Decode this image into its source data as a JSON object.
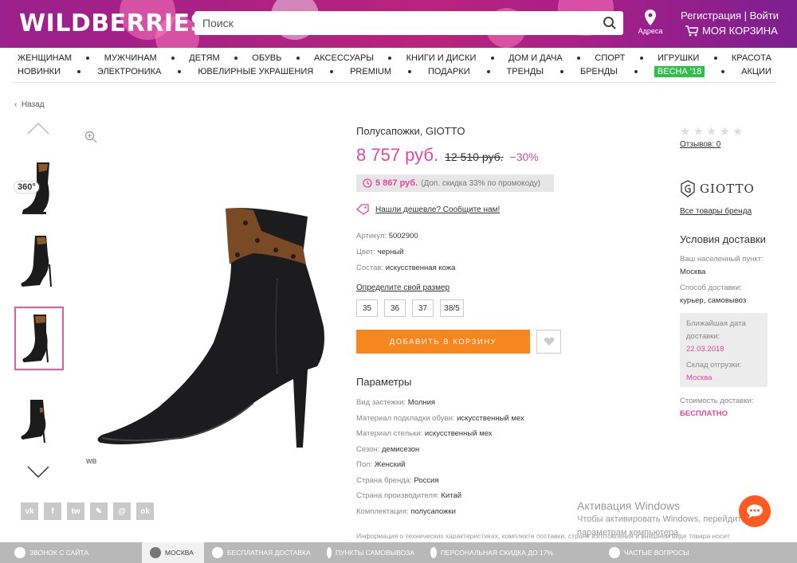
{
  "header": {
    "logo": "WILDBERRIES",
    "search_placeholder": "Поиск",
    "address_label": "Адреса",
    "register": "Регистрация",
    "login": "Войти",
    "separator": "|",
    "cart": "МОЯ КОРЗИНА"
  },
  "nav": {
    "row1": [
      "ЖЕНЩИНАМ",
      "МУЖЧИНАМ",
      "ДЕТЯМ",
      "ОБУВЬ",
      "АКСЕССУАРЫ",
      "КНИГИ И ДИСКИ",
      "ДОМ И ДАЧА",
      "СПОРТ",
      "ИГРУШКИ",
      "КРАСОТА"
    ],
    "row2": [
      "НОВИНКИ",
      "ЭЛЕКТРОНИКА",
      "ЮВЕЛИРНЫЕ УКРАШЕНИЯ",
      "PREMIUM",
      "ПОДАРКИ",
      "ТРЕНДЫ",
      "БРЕНДЫ",
      "ВЕСНА '18",
      "АКЦИИ"
    ]
  },
  "back": "Назад",
  "gallery": {
    "badge_360": "360°",
    "watermark": "WB"
  },
  "socials": [
    "vk",
    "f",
    "tw",
    "✎",
    "@",
    "ok"
  ],
  "product": {
    "title": "Полусапожки, GIOTTO",
    "price": "8 757 руб.",
    "old_price": "12 510 руб.",
    "discount": "−30%",
    "promo_price": "5 867 руб.",
    "promo_note": "(Доп. скидка 33% по промокоду)",
    "cheaper": "Нашли дешевле? Сообщите нам!",
    "specs": [
      {
        "label": "Артикул:",
        "value": "5002900"
      },
      {
        "label": "Цвет:",
        "value": "черный"
      },
      {
        "label": "Состав:",
        "value": "искусственная кожа"
      }
    ],
    "size_link": "Определите свой размер",
    "sizes": [
      "35",
      "36",
      "37",
      "38/5"
    ],
    "add_to_cart": "ДОБАВИТЬ В КОРЗИНУ",
    "params_title": "Параметры",
    "params": [
      {
        "label": "Вид застежки:",
        "value": "Молния"
      },
      {
        "label": "Материал подкладки обуви:",
        "value": "искусственный мех"
      },
      {
        "label": "Материал стельки:",
        "value": "искусственный мех"
      },
      {
        "label": "Сезон:",
        "value": "демисезон"
      },
      {
        "label": "Пол:",
        "value": "Женский"
      },
      {
        "label": "Страна бренда:",
        "value": "Россия"
      },
      {
        "label": "Страна производителя:",
        "value": "Китай"
      },
      {
        "label": "Комплектация:",
        "value": "полусапожки"
      }
    ],
    "info_note": "Информация о технических характеристиках, комплекте поставки, стране изготовления и внешнем виде товара носит"
  },
  "sidebar": {
    "reviews": "Отзывов: 0",
    "brand_name": "GIOTTO",
    "brand_link": "Все товары бренда",
    "delivery_title": "Условия доставки",
    "locality_label": "Ваш населенный пункт:",
    "locality": "Москва",
    "method_label": "Способ доставки:",
    "method": "курьер, самовывоз",
    "nearest_label": "Ближайшая дата доставки:",
    "nearest_date": "22.03.2018",
    "warehouse_label": "Склад отгрузки:",
    "warehouse": "Москва",
    "cost_label": "Стоимость доставки:",
    "cost": "БЕСПЛАТНО"
  },
  "activation": {
    "title": "Активация Windows",
    "line1": "Чтобы активировать Windows, перейдите к",
    "line2": "параметрам компьютера."
  },
  "footer": {
    "items": [
      "ЗВОНОК С САЙТА",
      "МОСКВА",
      "БЕСПЛАТНАЯ ДОСТАВКА",
      "ПУНКТЫ САМОВЫВОЗА",
      "ПЕРСОНАЛЬНАЯ СКИДКА ДО 17%",
      "ЧАСТЫЕ ВОПРОСЫ"
    ]
  },
  "colors": {
    "brand": "#b9237d",
    "accent_pink": "#e546a0",
    "cart_button": "#f7861e",
    "spring_badge": "#2fbf4a"
  }
}
